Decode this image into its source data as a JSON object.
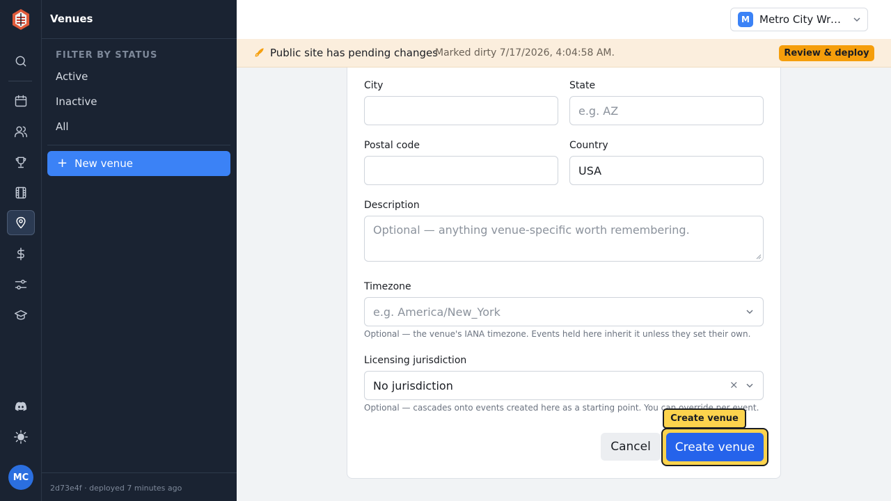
{
  "sidebar": {
    "title": "Venues",
    "filter_heading": "FILTER BY STATUS",
    "filters": [
      "Active",
      "Inactive",
      "All"
    ],
    "new_button": "New venue",
    "footer": "2d73e4f · deployed 7 minutes ago"
  },
  "rail": {
    "icons": [
      "search-icon",
      "calendar-icon",
      "users-icon",
      "trophy-icon",
      "film-icon",
      "map-pin-icon",
      "dollar-icon",
      "sliders-icon",
      "graduation-cap-icon",
      "discord-icon",
      "sun-icon"
    ],
    "active": "map-pin-icon",
    "avatar": "MC"
  },
  "org_switcher": {
    "initial": "M",
    "name": "Metro City Wrestling"
  },
  "banner": {
    "message": "Public site has pending changes",
    "detail": "Marked dirty 7/17/2026, 4:04:58 AM.",
    "action": "Review & deploy"
  },
  "form": {
    "city": {
      "label": "City",
      "value": ""
    },
    "state": {
      "label": "State",
      "placeholder": "e.g. AZ"
    },
    "postal_code": {
      "label": "Postal code",
      "value": ""
    },
    "country": {
      "label": "Country",
      "value": "USA"
    },
    "description": {
      "label": "Description",
      "placeholder": "Optional — anything venue-specific worth remembering."
    },
    "timezone": {
      "label": "Timezone",
      "placeholder": "e.g. America/New_York",
      "help": "Optional — the venue's IANA timezone. Events held here inherit it unless they set their own."
    },
    "jurisdiction": {
      "label": "Licensing jurisdiction",
      "value": "No jurisdiction",
      "help": "Optional — cascades onto events created here as a starting point. You can override per event."
    },
    "cancel": "Cancel",
    "submit": "Create venue",
    "tooltip": "Create venue"
  },
  "colors": {
    "primary": "#2563eb",
    "sidebar_bg": "#1a2332",
    "banner_bg": "#fbeedd",
    "highlight": "#fcd34d"
  }
}
